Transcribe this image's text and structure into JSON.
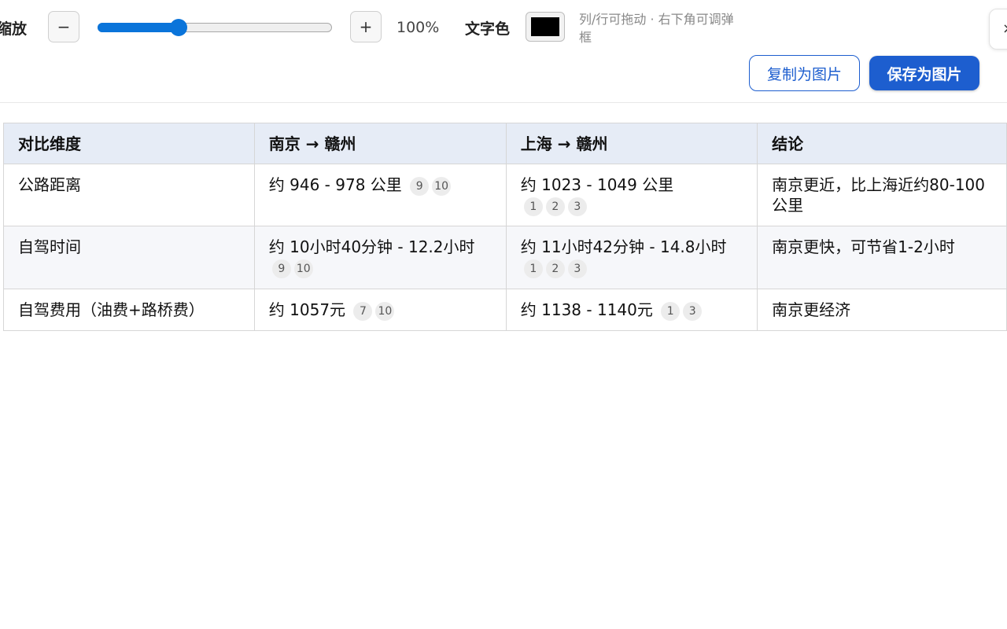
{
  "toolbar": {
    "zoom_label": "缩放",
    "minus_label": "−",
    "plus_label": "+",
    "zoom_value": "100%",
    "zoom_slider_fraction": 0.345,
    "text_color_label": "文字色",
    "text_color": "#000000",
    "hint": "列/行可拖动 · 右下角可调弹框",
    "close_glyph": "×",
    "copy_label": "复制为图片",
    "save_label": "保存为图片"
  },
  "colors": {
    "accent": "#1d5ecf",
    "slider": "#0a74da",
    "header_bg": "#e6ecf6"
  },
  "table": {
    "headers": [
      "对比维度",
      "南京 → 赣州",
      "上海 → 赣州",
      "结论"
    ],
    "rows": [
      {
        "dimension": "公路距离",
        "nanjing": {
          "text": "约 946 - 978 公里",
          "cites": [
            "9",
            "10"
          ]
        },
        "shanghai": {
          "text": "约 1023 - 1049 公里",
          "cites": [
            "1",
            "2",
            "3"
          ]
        },
        "conclusion": "南京更近，比上海近约80-100公里"
      },
      {
        "dimension": "自驾时间",
        "nanjing": {
          "text": "约 10小时40分钟 - 12.2小时",
          "cites": [
            "9",
            "10"
          ]
        },
        "shanghai": {
          "text": "约 11小时42分钟 - 14.8小时",
          "cites": [
            "1",
            "2",
            "3"
          ]
        },
        "conclusion": "南京更快，可节省1-2小时"
      },
      {
        "dimension": "自驾费用（油费+路桥费）",
        "nanjing": {
          "text": "约 1057元",
          "cites": [
            "7",
            "10"
          ]
        },
        "shanghai": {
          "text": "约 1138 - 1140元",
          "cites": [
            "1",
            "3"
          ]
        },
        "conclusion": "南京更经济"
      }
    ]
  }
}
